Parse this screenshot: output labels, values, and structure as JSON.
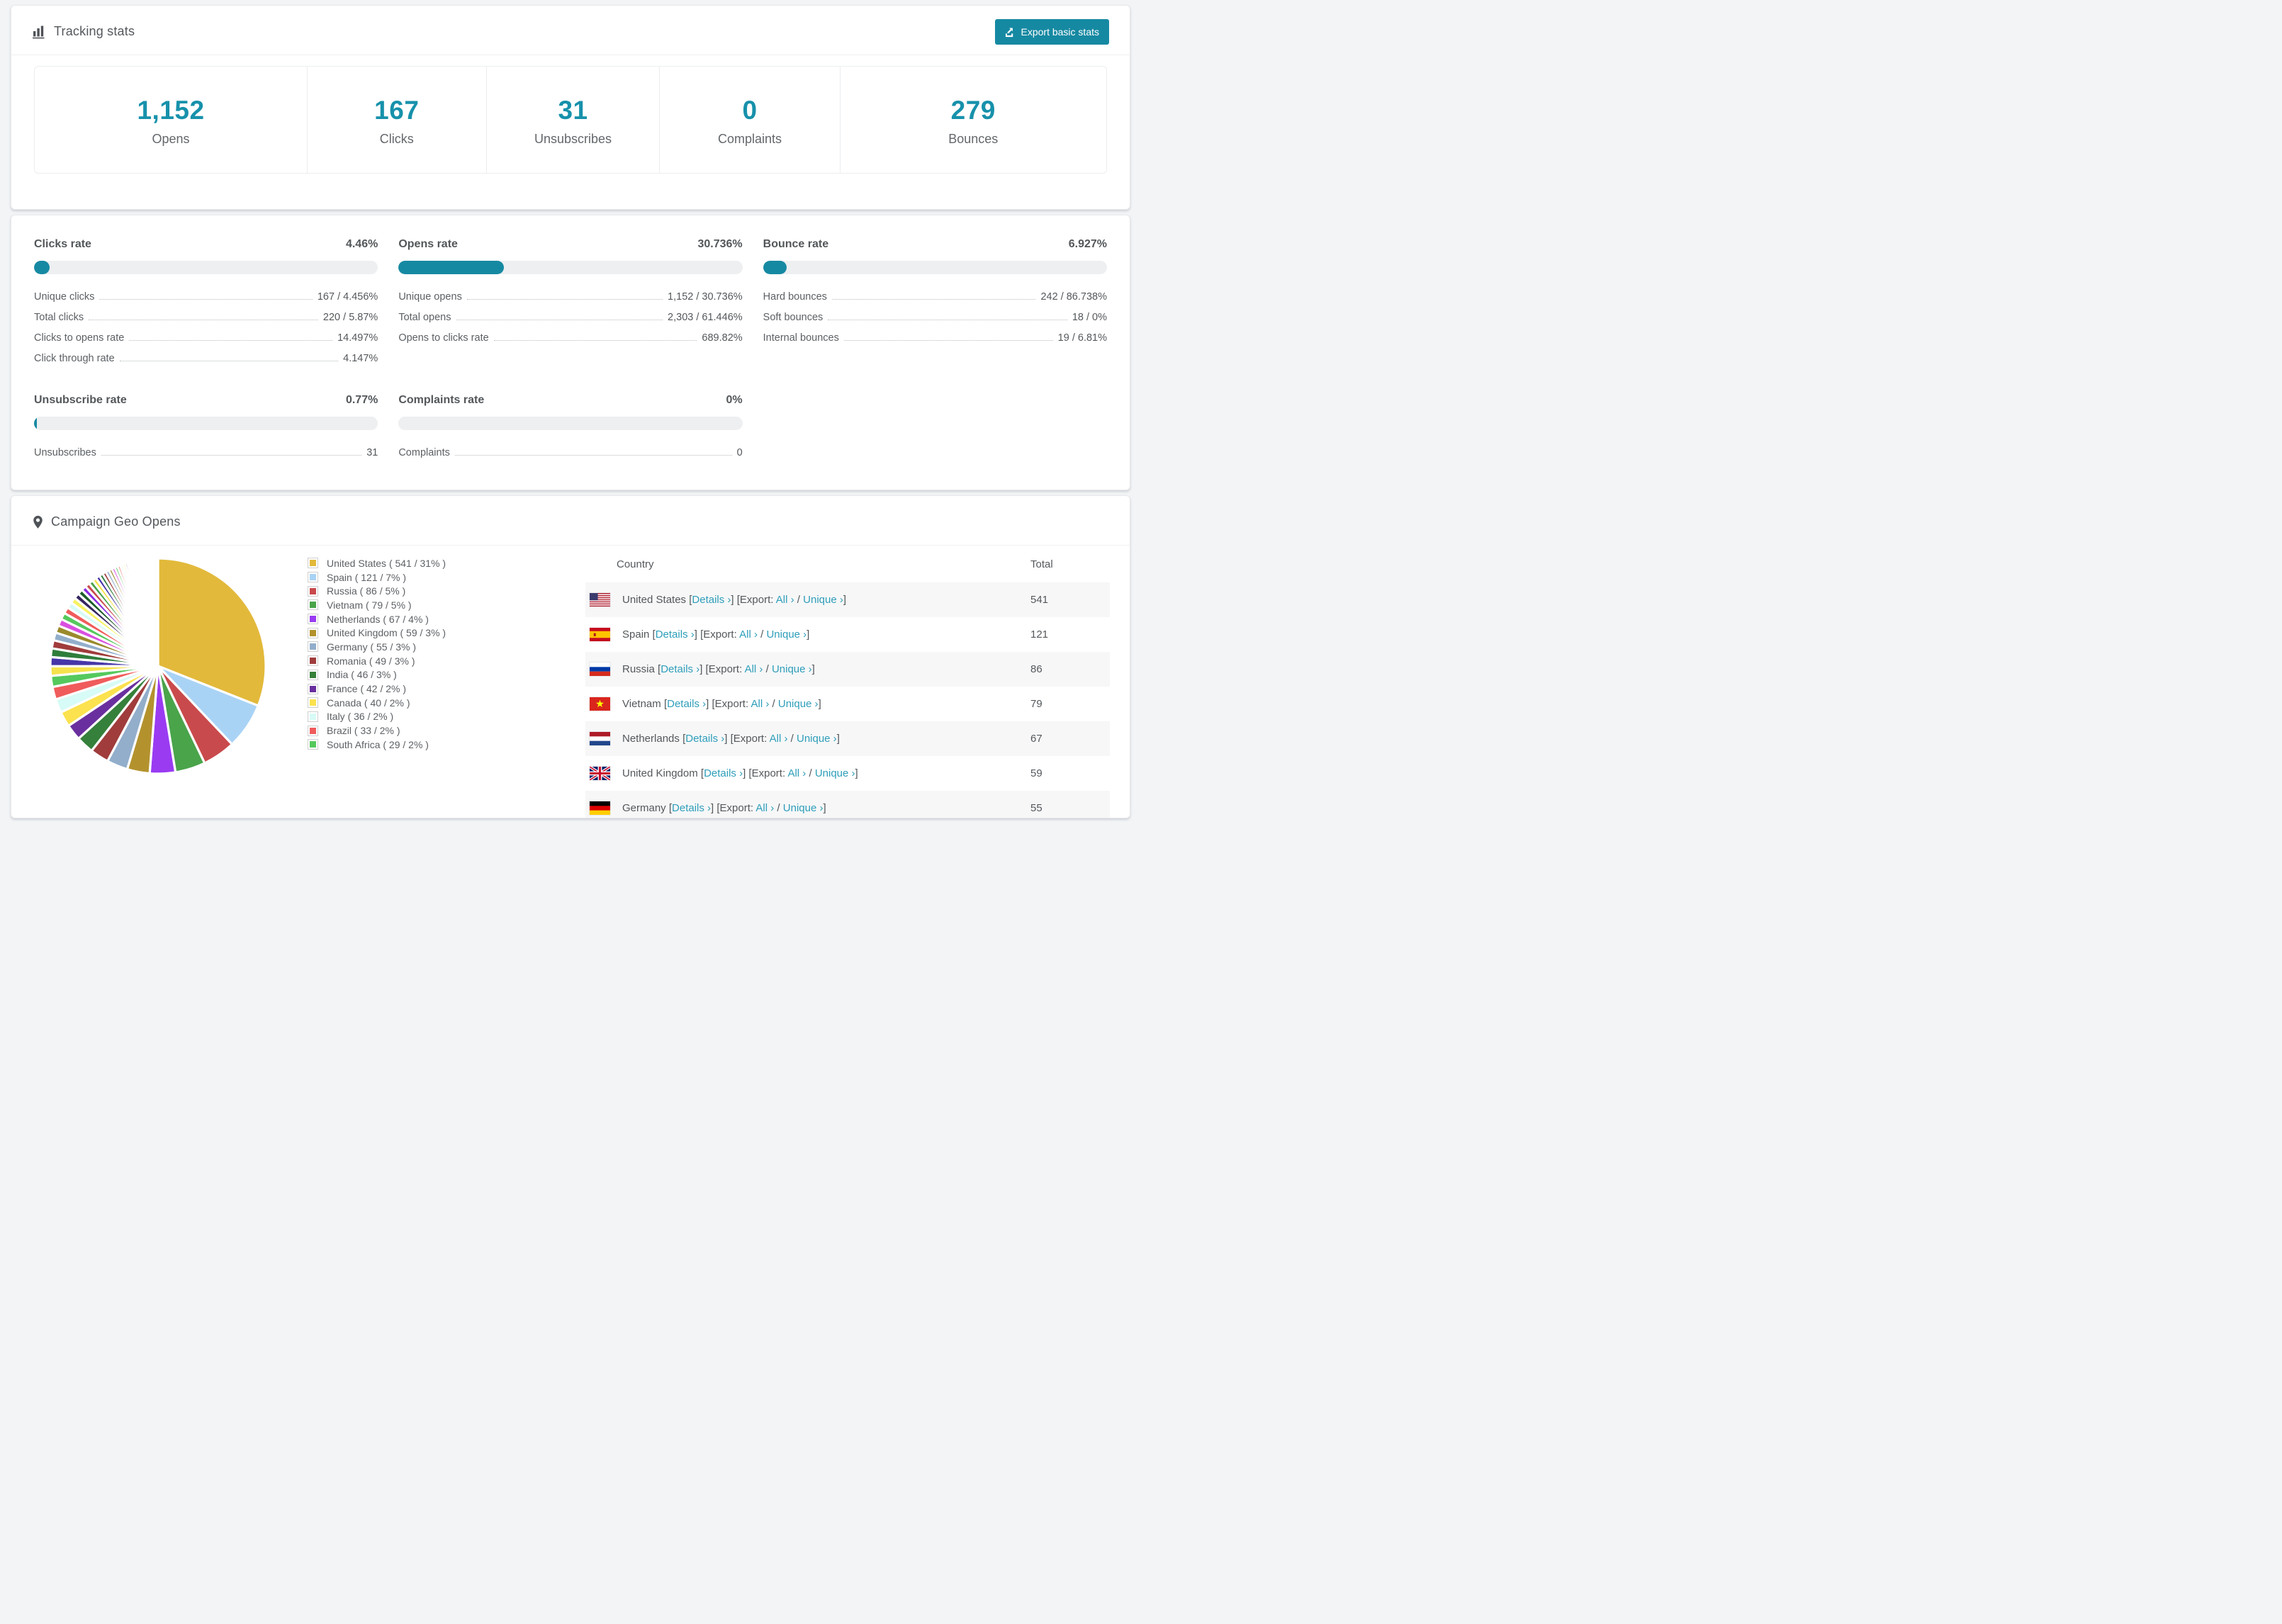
{
  "page": {
    "background": "#f3f4f6",
    "accent_teal": "#1689a2",
    "link_teal": "#2e9eb9"
  },
  "tracking": {
    "title": "Tracking stats",
    "export_button_label": "Export basic stats",
    "stats": [
      {
        "value": "1,152",
        "label": "Opens"
      },
      {
        "value": "167",
        "label": "Clicks"
      },
      {
        "value": "31",
        "label": "Unsubscribes"
      },
      {
        "value": "0",
        "label": "Complaints"
      },
      {
        "value": "279",
        "label": "Bounces"
      }
    ]
  },
  "rates": {
    "blocks": [
      {
        "id": "clicks",
        "title": "Clicks rate",
        "value": "4.46%",
        "percent": 4.46,
        "rows": [
          {
            "label": "Unique clicks",
            "value": "167 / 4.456%"
          },
          {
            "label": "Total clicks",
            "value": "220 / 5.87%"
          },
          {
            "label": "Clicks to opens rate",
            "value": "14.497%"
          },
          {
            "label": "Click through rate",
            "value": "4.147%"
          }
        ]
      },
      {
        "id": "opens",
        "title": "Opens rate",
        "value": "30.736%",
        "percent": 30.736,
        "rows": [
          {
            "label": "Unique opens",
            "value": "1,152 / 30.736%"
          },
          {
            "label": "Total opens",
            "value": "2,303 / 61.446%"
          },
          {
            "label": "Opens to clicks rate",
            "value": "689.82%"
          }
        ]
      },
      {
        "id": "bounce",
        "title": "Bounce rate",
        "value": "6.927%",
        "percent": 6.927,
        "rows": [
          {
            "label": "Hard bounces",
            "value": "242 / 86.738%"
          },
          {
            "label": "Soft bounces",
            "value": "18 / 0%"
          },
          {
            "label": "Internal bounces",
            "value": "19 / 6.81%"
          }
        ]
      },
      {
        "id": "unsubscribe",
        "title": "Unsubscribe rate",
        "value": "0.77%",
        "percent": 0.77,
        "rows": [
          {
            "label": "Unsubscribes",
            "value": "31"
          }
        ]
      },
      {
        "id": "complaints",
        "title": "Complaints rate",
        "value": "0%",
        "percent": 0,
        "rows": [
          {
            "label": "Complaints",
            "value": "0"
          }
        ]
      }
    ]
  },
  "geo": {
    "title": "Campaign Geo Opens",
    "table": {
      "columns": [
        "Country",
        "Total"
      ],
      "link_labels": {
        "details": "Details ›",
        "export_prefix": "Export:",
        "all": "All ›",
        "unique": "Unique ›"
      },
      "rows": [
        {
          "country": "United States",
          "flag": "us",
          "total": "541"
        },
        {
          "country": "Spain",
          "flag": "es",
          "total": "121"
        },
        {
          "country": "Russia",
          "flag": "ru",
          "total": "86"
        },
        {
          "country": "Vietnam",
          "flag": "vn",
          "total": "79"
        },
        {
          "country": "Netherlands",
          "flag": "nl",
          "total": "67"
        },
        {
          "country": "United Kingdom",
          "flag": "gb",
          "total": "59"
        },
        {
          "country": "Germany",
          "flag": "de",
          "total": "55"
        }
      ]
    },
    "chart_data": {
      "type": "pie",
      "title": "Campaign Geo Opens",
      "legend_position": "right",
      "start_angle_deg": 0,
      "direction": "clockwise",
      "legend_format": "{label} ( {value} / {pct} )",
      "series": [
        {
          "label": "United States",
          "value": 541,
          "pct": "31%",
          "color": "#e2b93b"
        },
        {
          "label": "Spain",
          "value": 121,
          "pct": "7%",
          "color": "#a9d3f5"
        },
        {
          "label": "Russia",
          "value": 86,
          "pct": "5%",
          "color": "#c94a4c"
        },
        {
          "label": "Vietnam",
          "value": 79,
          "pct": "5%",
          "color": "#4aa44a"
        },
        {
          "label": "Netherlands",
          "value": 67,
          "pct": "4%",
          "color": "#9a3bf2"
        },
        {
          "label": "United Kingdom",
          "value": 59,
          "pct": "3%",
          "color": "#b3922e"
        },
        {
          "label": "Germany",
          "value": 55,
          "pct": "3%",
          "color": "#92aecb"
        },
        {
          "label": "Romania",
          "value": 49,
          "pct": "3%",
          "color": "#a03c3c"
        },
        {
          "label": "India",
          "value": 46,
          "pct": "3%",
          "color": "#35803a"
        },
        {
          "label": "France",
          "value": 42,
          "pct": "2%",
          "color": "#6a2f9e"
        },
        {
          "label": "Canada",
          "value": 40,
          "pct": "2%",
          "color": "#fbe24e"
        },
        {
          "label": "Italy",
          "value": 36,
          "pct": "2%",
          "color": "#d7fbf6"
        },
        {
          "label": "Brazil",
          "value": 33,
          "pct": "2%",
          "color": "#f05c5c"
        },
        {
          "label": "South Africa",
          "value": 29,
          "pct": "2%",
          "color": "#55c95d"
        }
      ],
      "others_estimated_values": [
        25,
        23.8,
        22.6,
        21.4,
        20.4,
        19.3,
        18.4,
        17.5,
        16.6,
        15.8,
        15,
        14.2,
        13.5,
        12.8,
        12.2,
        11.6,
        11,
        10.5,
        9.9,
        9.4,
        9,
        8.5,
        8.1,
        7.7,
        7.3,
        6.9,
        6.6,
        6.3,
        5.9,
        5.6,
        5.4,
        5.1,
        4.8,
        4.6,
        4.4,
        4.2,
        3.9,
        3.7,
        3.6,
        3.4,
        3.2,
        3,
        2.9,
        2.8,
        2.6,
        2.5,
        2.4,
        2.2,
        2.1,
        2
      ],
      "others_palette": [
        "#f5e24e",
        "#4636a8",
        "#2f7d3b",
        "#a03c3c",
        "#92aecb",
        "#9a8a2c",
        "#d94fe0",
        "#55c95d",
        "#f05c5c",
        "#d7fbf6",
        "#f7f263",
        "#35265e",
        "#1f5d2b",
        "#8a2be2",
        "#c94a4c",
        "#4aa44a"
      ]
    }
  }
}
